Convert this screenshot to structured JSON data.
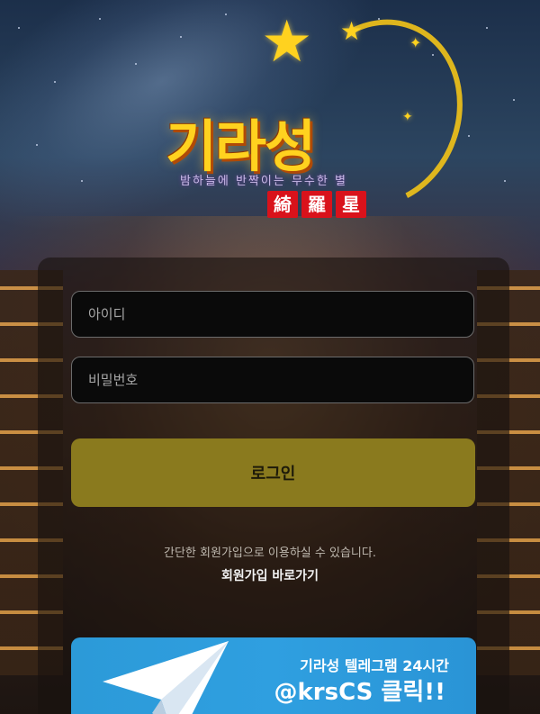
{
  "logo": {
    "title": "기라성",
    "tagline": "밤하늘에 반짝이는 무수한 별",
    "hanja": [
      "綺",
      "羅",
      "星"
    ]
  },
  "login": {
    "id_placeholder": "아이디",
    "password_placeholder": "비밀번호",
    "submit_label": "로그인"
  },
  "signup": {
    "hint": "간단한 회원가입으로 이용하실 수 있습니다.",
    "link_label": "회원가입 바로가기"
  },
  "telegram": {
    "line1": "기라성 텔레그램 24시간",
    "line2": "@krsCS 클릭!!"
  },
  "colors": {
    "accent_gold": "#ffd21f",
    "login_button": "#8a7a1e",
    "telegram_blue": "#2c9ad8",
    "hanja_red": "#d9121b"
  },
  "icons": [
    "star-icon",
    "telegram-plane-icon"
  ]
}
